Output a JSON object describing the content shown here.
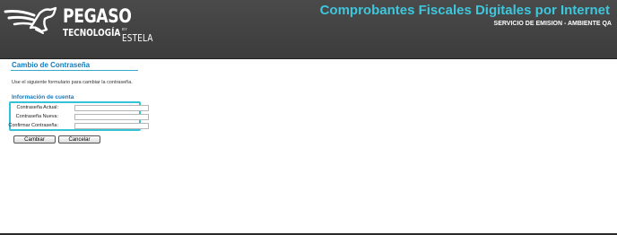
{
  "header": {
    "logo": {
      "brand": "PEGASO",
      "tagline": "TECNOLOGÍA",
      "by": "BY",
      "product": "ESTELA"
    },
    "title": "Comprobantes Fiscales Digitales por Internet",
    "subtitle": "SERVICIO DE EMISION - AMBIENTE QA",
    "colors": {
      "background": "#3f3f3f",
      "title": "#3ec6dc"
    }
  },
  "page": {
    "title": "Cambio de Contraseña",
    "instructions": "Use el siguiente formulario para cambiar la contraseña.",
    "section_title": "Información de cuenta"
  },
  "form": {
    "fields": [
      {
        "label": "Contraseña Actual:",
        "value": ""
      },
      {
        "label": "Contraseña Nueva:",
        "value": ""
      },
      {
        "label": "Confirmar Contraseña:",
        "value": ""
      }
    ],
    "buttons": {
      "change": "Cambiar",
      "cancel": "Cancelar"
    },
    "highlight_color": "#34c2d6"
  },
  "icons": {
    "logo_mark": "pegasus-horse-icon"
  }
}
